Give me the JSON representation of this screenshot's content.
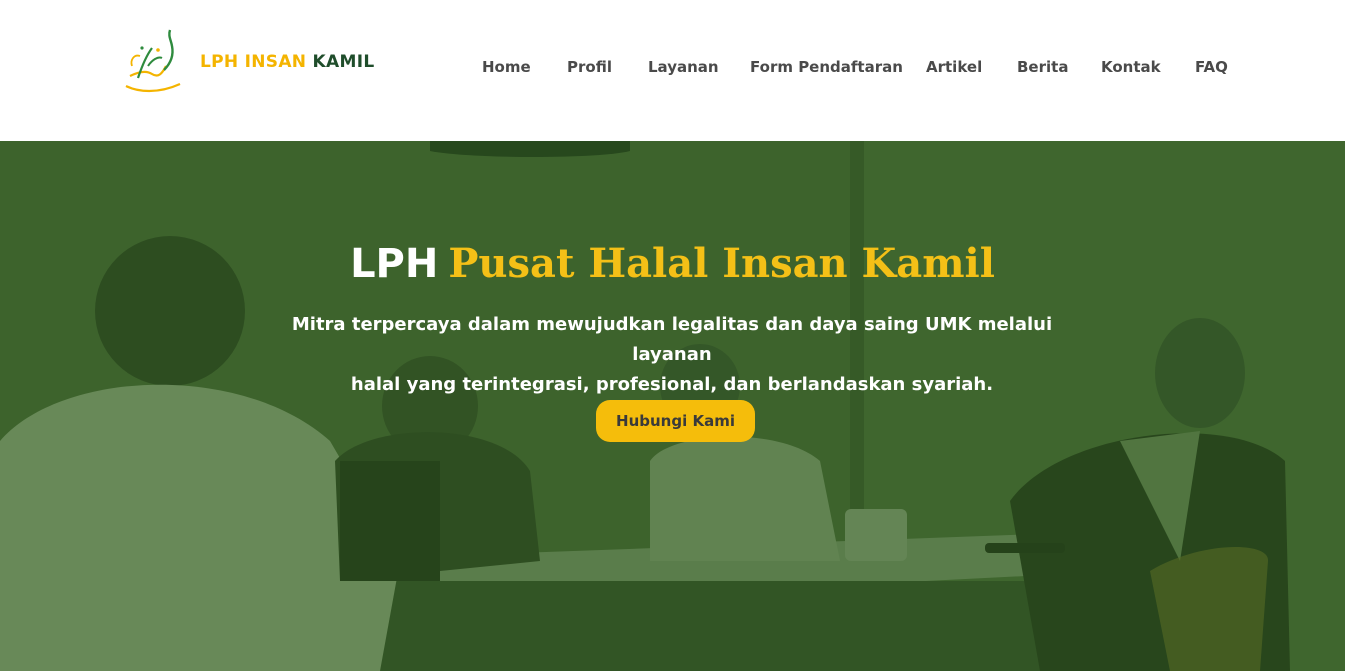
{
  "brand": {
    "logo_icon": "arabic-calligraphy-logo",
    "name_part1": "LPH INSAN",
    "name_part2": "KAMIL",
    "colors": {
      "gold": "#f4b400",
      "green": "#1f4d2b"
    }
  },
  "nav": {
    "items": [
      {
        "label": "Home"
      },
      {
        "label": "Profil"
      },
      {
        "label": "Layanan"
      },
      {
        "label": "Form Pendaftaran"
      },
      {
        "label": "Artikel"
      },
      {
        "label": "Berita"
      },
      {
        "label": "Kontak"
      },
      {
        "label": "FAQ"
      }
    ]
  },
  "hero": {
    "title_white": "LPH",
    "title_gold": "Pusat Halal Insan Kamil",
    "subtitle_line1": "Mitra terpercaya dalam mewujudkan legalitas dan daya saing UMK melalui layanan",
    "subtitle_line2": "halal yang terintegrasi, profesional, dan berlandaskan syariah.",
    "cta_label": "Hubungi Kami",
    "overlay_color": "#3f5f2f",
    "accent_color": "#f4c017",
    "button_color": "#f5bd0b"
  }
}
